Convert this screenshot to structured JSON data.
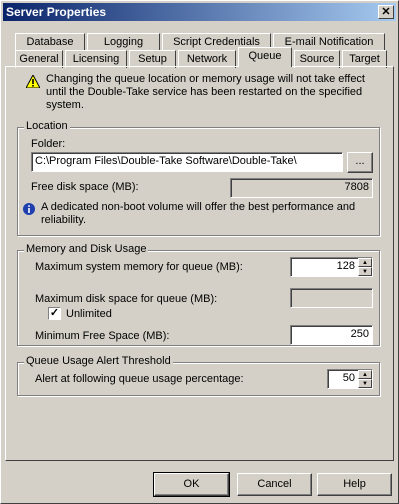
{
  "window": {
    "title": "Server Properties",
    "close_glyph": "✕"
  },
  "tabs_row1": [
    "Database",
    "Logging",
    "Script Credentials",
    "E-mail Notification"
  ],
  "tabs_row2": [
    "General",
    "Licensing",
    "Setup",
    "Network",
    "Queue",
    "Source",
    "Target"
  ],
  "active_tab": "Queue",
  "warning": {
    "icon": "warning-icon",
    "text": "Changing the queue location or memory usage will not take effect until the Double-Take service has been restarted on the specified system."
  },
  "location": {
    "legend": "Location",
    "folder_label": "Folder:",
    "folder_value": "C:\\Program Files\\Double-Take Software\\Double-Take\\",
    "browse_label": "...",
    "free_disk_label": "Free disk space (MB):",
    "free_disk_value": "7808",
    "info_icon": "info-icon",
    "info_text": "A dedicated non-boot volume will offer the best performance and reliability."
  },
  "memory": {
    "legend": "Memory and Disk Usage",
    "max_memory_label": "Maximum system memory for queue (MB):",
    "max_memory_value": "128",
    "max_disk_label": "Maximum disk space for queue (MB):",
    "max_disk_value": "",
    "unlimited_label": "Unlimited",
    "unlimited_checked": true,
    "min_free_label": "Minimum Free Space (MB):",
    "min_free_value": "250"
  },
  "alert": {
    "legend": "Queue Usage Alert Threshold",
    "alert_label": "Alert at following queue usage percentage:",
    "alert_value": "50"
  },
  "buttons": {
    "ok": "OK",
    "cancel": "Cancel",
    "help": "Help"
  }
}
